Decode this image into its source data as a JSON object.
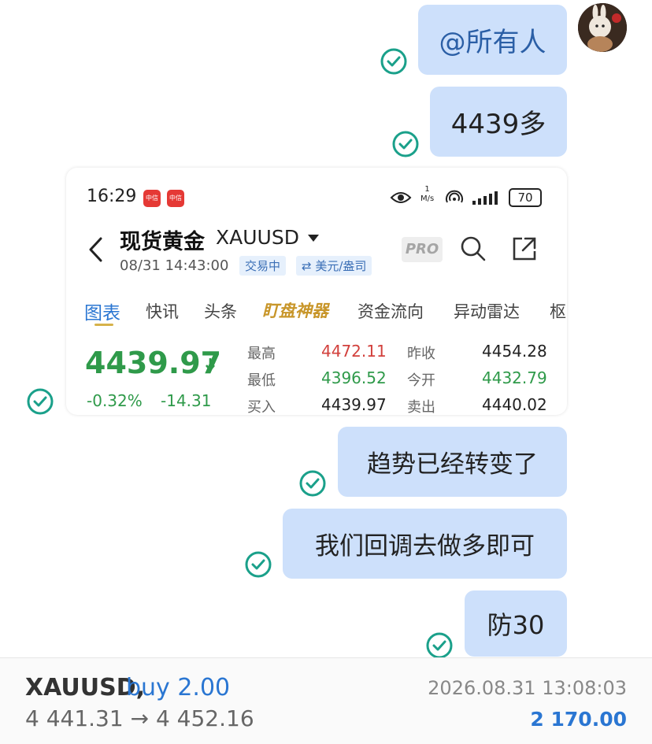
{
  "messages": [
    {
      "text": "@所有人"
    },
    {
      "text": "4439多"
    },
    {
      "text": "趋势已经转变了"
    },
    {
      "text": "我们回调去做多即可"
    },
    {
      "text": "防30"
    }
  ],
  "screenshot": {
    "status_time": "16:29",
    "status_badges": [
      "中信",
      "中信"
    ],
    "battery": "70",
    "speed_top": "1",
    "speed_unit": "M/s",
    "title_cn": "现货黄金",
    "title_symbol": "XAUUSD",
    "datetime": "08/31 14:43:00",
    "trading_status": "交易中",
    "currency_unit": "⇄ 美元/盎司",
    "pro_label": "PRO",
    "tabs": [
      "图表",
      "快讯",
      "头条",
      "盯盘神器",
      "资金流向",
      "异动雷达",
      "枢"
    ],
    "price": "4439.97",
    "change_pct": "-0.32%",
    "change_abs": "-14.31",
    "stats": [
      {
        "label": "最高",
        "value": "4472.11"
      },
      {
        "label": "最低",
        "value": "4396.52"
      },
      {
        "label": "买入",
        "value": "4439.97"
      },
      {
        "label": "昨收",
        "value": "4454.28"
      },
      {
        "label": "今开",
        "value": "4432.79"
      },
      {
        "label": "卖出",
        "value": "4440.02"
      }
    ]
  },
  "trade": {
    "symbol": "XAUUSD,",
    "action": "buy 2.00",
    "prices": "4 441.31 → 4 452.16",
    "timestamp": "2026.08.31 13:08:03",
    "profit": "2 170.00"
  },
  "colors": {
    "check": "#1aa08a",
    "bubble": "#cde0fb",
    "down_green": "#2f9a4a",
    "up_red": "#d2403c",
    "blue": "#2a76d2",
    "gold": "#c8962a"
  },
  "icons": [
    "check-icon",
    "back-icon",
    "dropdown-icon",
    "search-icon",
    "share-icon",
    "eye-icon",
    "down-arrow-icon"
  ]
}
